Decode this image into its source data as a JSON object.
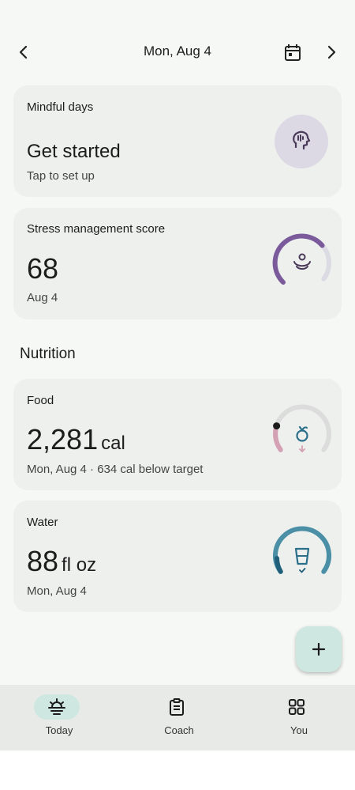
{
  "header": {
    "date": "Mon, Aug 4"
  },
  "cards": {
    "mindful": {
      "label": "Mindful days",
      "title": "Get started",
      "sub": "Tap to set up"
    },
    "stress": {
      "label": "Stress management score",
      "value": "68",
      "sub": "Aug 4",
      "score": 68,
      "max": 100,
      "color": "#7a5a9a"
    },
    "food": {
      "label": "Food",
      "value": "2,281",
      "unit": "cal",
      "sub": "Mon, Aug 4 · 634 cal below target",
      "color": "#d4a0b4",
      "icon_color": "#2b6f8a"
    },
    "water": {
      "label": "Water",
      "value": "88",
      "unit": "fl oz",
      "sub": "Mon, Aug 4",
      "color": "#4a8fa6"
    }
  },
  "nutrition": {
    "heading": "Nutrition"
  },
  "fab": {
    "icon": "plus-icon"
  },
  "nav": {
    "items": [
      {
        "label": "Today",
        "icon": "sunrise-icon",
        "active": true
      },
      {
        "label": "Coach",
        "icon": "clipboard-icon",
        "active": false
      },
      {
        "label": "You",
        "icon": "grid-icon",
        "active": false
      }
    ]
  }
}
